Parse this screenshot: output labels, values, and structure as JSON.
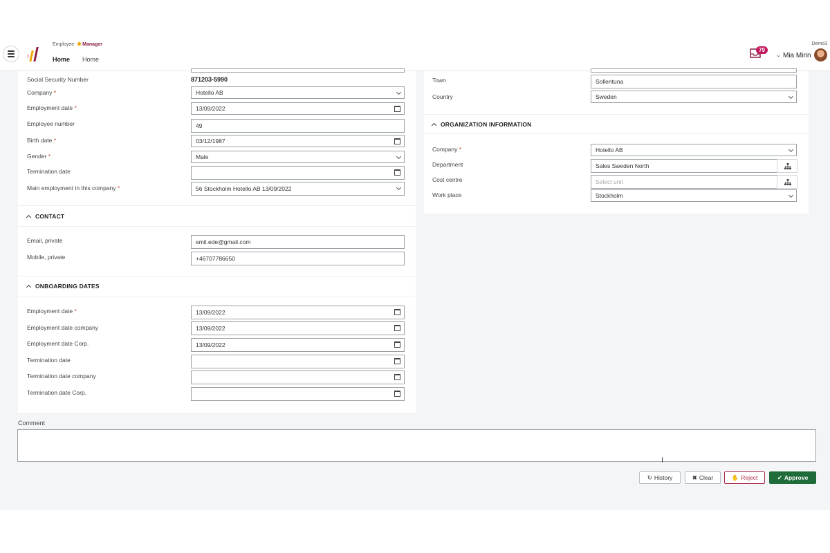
{
  "header": {
    "roles": [
      "Employee",
      "Manager"
    ],
    "nav": [
      "Home",
      "Home"
    ],
    "company": "Demo3",
    "inbox_count": "79",
    "user_name": "Mia Mirin"
  },
  "personal": {
    "ssn_label": "Social Security Number",
    "ssn_value": "871203-5990",
    "rows": [
      {
        "label": "Company",
        "required": "*",
        "value": "Hotello AB"
      },
      {
        "label": "Employment date",
        "required": "*",
        "value": "13/09/2022"
      },
      {
        "label": "Employee number",
        "required": "",
        "value": "49"
      },
      {
        "label": "Birth date",
        "required": "*",
        "value": "03/12/1987"
      },
      {
        "label": "Gender",
        "required": "*",
        "value": "Male"
      },
      {
        "label": "Termination date",
        "required": "",
        "value": ""
      },
      {
        "label": "Main employment in this company",
        "required": "*",
        "value": "56 Stockholm Hotello AB 13/09/2022"
      }
    ]
  },
  "contact": {
    "title": "CONTACT",
    "rows": [
      {
        "label": "Email, private",
        "value": "emil.ede@gmail.com"
      },
      {
        "label": "Mobile, private",
        "value": "+46707786650"
      }
    ]
  },
  "onboarding": {
    "title": "ONBOARDING DATES",
    "rows": [
      {
        "label": "Employment date",
        "required": "*",
        "value": "13/09/2022"
      },
      {
        "label": "Employment date company",
        "required": "",
        "value": "13/09/2022"
      },
      {
        "label": "Employment date Corp.",
        "required": "",
        "value": "13/09/2022"
      },
      {
        "label": "Termination date",
        "required": "",
        "value": ""
      },
      {
        "label": "Termination date company",
        "required": "",
        "value": ""
      },
      {
        "label": "Termination date Corp.",
        "required": "",
        "value": ""
      }
    ]
  },
  "address": {
    "rows": [
      {
        "label": "Town",
        "value": "Sollentuna"
      },
      {
        "label": "Country",
        "value": "Sweden"
      }
    ]
  },
  "organization": {
    "title": "ORGANIZATION INFORMATION",
    "rows": [
      {
        "label": "Company",
        "required": "*",
        "value": "Hotello AB"
      },
      {
        "label": "Department",
        "required": "",
        "value": "Sales Sweden North"
      },
      {
        "label": "Cost centre",
        "required": "",
        "value": "",
        "placeholder": "Select unit"
      },
      {
        "label": "Work place",
        "required": "",
        "value": "Stockholm"
      }
    ]
  },
  "comment": {
    "label": "Comment",
    "value": ""
  },
  "actions": {
    "history": "History",
    "clear": "Clear",
    "reject": "Reject",
    "approve": "Approve"
  },
  "colors": {
    "approve": "#1f6b3a",
    "reject": "#b0304f",
    "badge": "#c2185b",
    "accent": "#f0a500"
  }
}
